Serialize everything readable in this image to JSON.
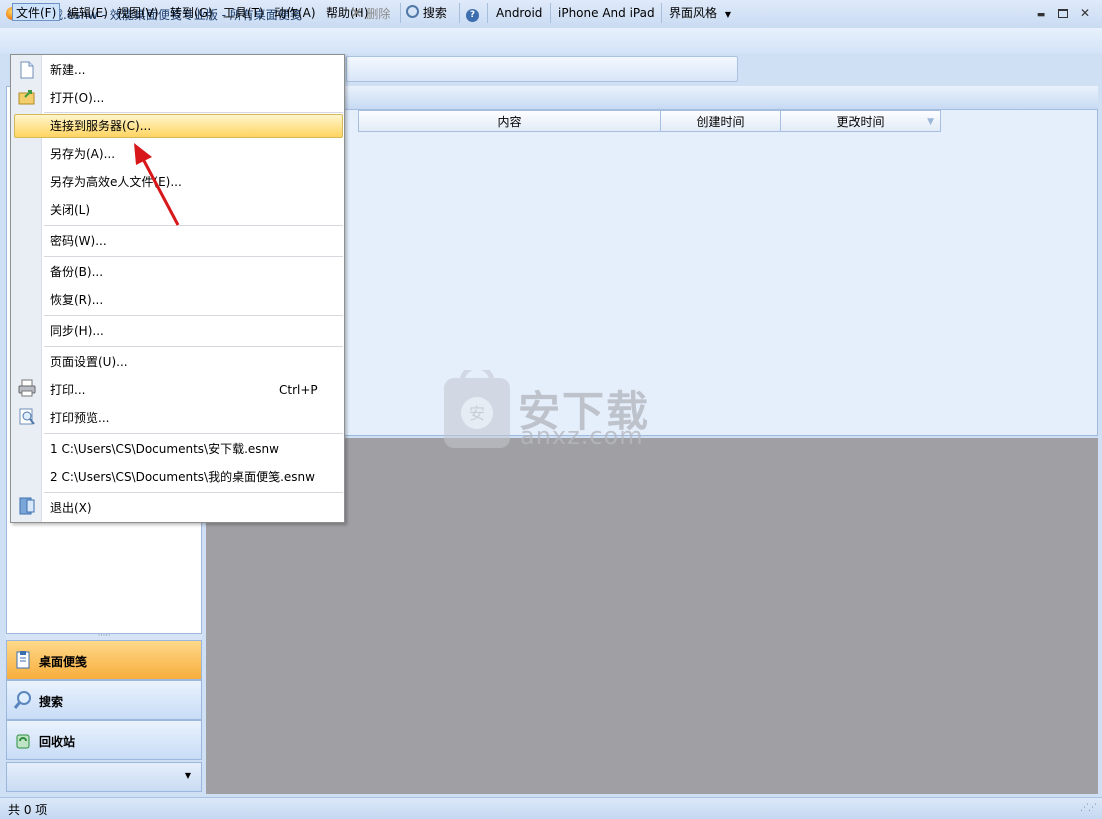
{
  "window": {
    "title": "安下载.esnw - 效能桌面便笺专业版 - 所有桌面便笺",
    "minimize": "▬",
    "maximize": "■",
    "close": "✕"
  },
  "menubar": [
    "文件(F)",
    "编辑(E)",
    "视图(V)",
    "转到(G)",
    "工具(T)",
    "动作(A)",
    "帮助(H)"
  ],
  "toolbar": {
    "delete": "删除",
    "search": "搜索",
    "android": "Android",
    "iphone": "iPhone And iPad",
    "style": "界面风格"
  },
  "columns": [
    "内容",
    "创建时间",
    "更改时间"
  ],
  "file_menu": {
    "new": "新建...",
    "open": "打开(O)...",
    "connect": "连接到服务器(C)...",
    "save_as": "另存为(A)...",
    "save_as_eperson": "另存为高效e人文件(E)...",
    "close": "关闭(L)",
    "password": "密码(W)...",
    "backup": "备份(B)...",
    "restore": "恢复(R)...",
    "sync": "同步(H)...",
    "page_setup": "页面设置(U)...",
    "print": "打印...",
    "print_shortcut": "Ctrl+P",
    "print_preview": "打印预览...",
    "recent1": "1 C:\\Users\\CS\\Documents\\安下载.esnw",
    "recent2": "2 C:\\Users\\CS\\Documents\\我的桌面便笺.esnw",
    "exit": "退出(X)"
  },
  "nav": {
    "notes": "桌面便笺",
    "search": "搜索",
    "recycle": "回收站"
  },
  "status": "共 0 项",
  "watermark": {
    "cn": "安下载",
    "en": "anxz.com"
  },
  "colors": {
    "highlight": "#ffd561",
    "accent": "#f7ae3c",
    "arrow": "#d8171b"
  }
}
